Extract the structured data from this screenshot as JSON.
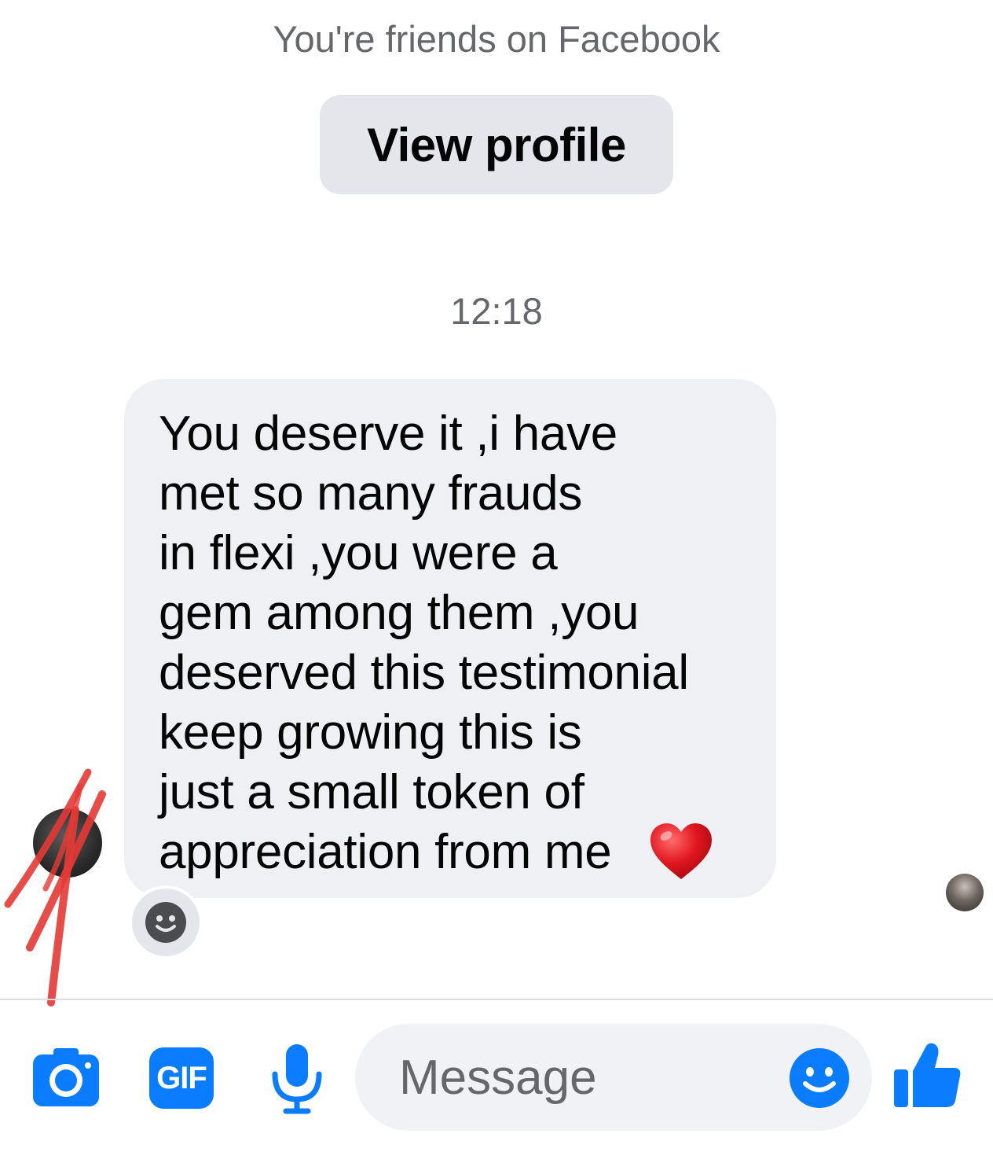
{
  "conversation": {
    "friends_note": "You're friends on Facebook",
    "view_profile_label": "View profile",
    "timestamp": "12:18"
  },
  "message": {
    "text": "You deserve it ,i have\nmet so many frauds\nin flexi ,you were a\ngem among them ,you\ndeserved this testimonial\nkeep growing this is\njust a small token of\nappreciation from me",
    "emoji": "heart-icon",
    "bubble_color": "#eff0f3"
  },
  "composer": {
    "gif_label": "GIF",
    "message_placeholder": "Message",
    "icons": [
      "camera-icon",
      "gif-icon",
      "microphone-icon",
      "smiley-icon",
      "thumbs-up-icon"
    ]
  },
  "colors": {
    "accent": "#0a7cff",
    "secondary_text": "#65676b",
    "annotation_red": "#e53935"
  }
}
